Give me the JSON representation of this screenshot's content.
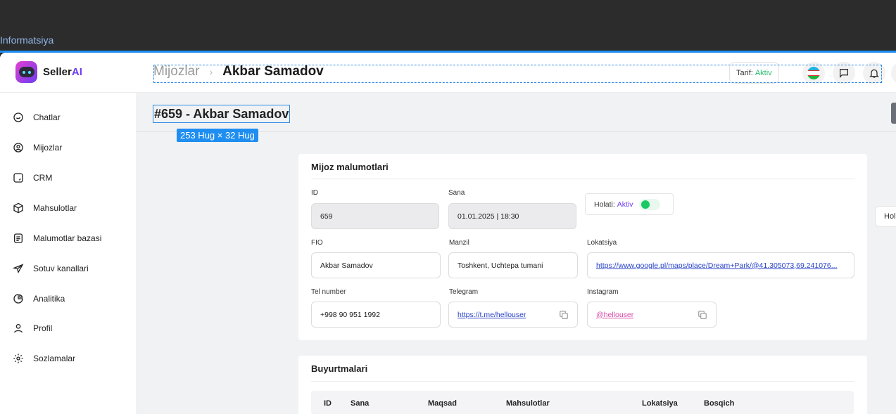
{
  "frame": {
    "label": "Informatsiya"
  },
  "brand": {
    "name_prefix": "Seller",
    "name_suffix": "AI"
  },
  "breadcrumb": {
    "parent": "Mijozlar",
    "separator": "›",
    "current": "Akbar Samadov"
  },
  "header": {
    "tariff_label": "Tarif:",
    "tariff_value": "Aktiv"
  },
  "sidebar": {
    "items": [
      {
        "label": "Chatlar",
        "icon": "chat-icon"
      },
      {
        "label": "Mijozlar",
        "icon": "user-circle-icon"
      },
      {
        "label": "CRM",
        "icon": "crm-icon"
      },
      {
        "label": "Mahsulotlar",
        "icon": "box-icon"
      },
      {
        "label": "Malumotlar bazasi",
        "icon": "document-icon"
      },
      {
        "label": "Sotuv kanallari",
        "icon": "send-icon"
      },
      {
        "label": "Analitika",
        "icon": "analytics-icon"
      },
      {
        "label": "Profil",
        "icon": "profile-icon"
      },
      {
        "label": "Sozlamalar",
        "icon": "gear-icon"
      }
    ]
  },
  "page": {
    "title": "#659 - Akbar Samadov",
    "size_badge": "253 Hug × 32 Hug",
    "side_chip": "Hol"
  },
  "client": {
    "section_title": "Mijoz malumotlari",
    "id_label": "ID",
    "id_value": "659",
    "date_label": "Sana",
    "date_value": "01.01.2025 | 18:30",
    "status_label": "Holati:",
    "status_value": "Aktiv",
    "fio_label": "FIO",
    "fio_value": "Akbar Samadov",
    "address_label": "Manzil",
    "address_value": "Toshkent, Uchtepa tumani",
    "location_label": "Lokatsiya",
    "location_value": "https://www.google.pl/maps/place/Dream+Park/@41.305073,69.241076...",
    "phone_label": "Tel number",
    "phone_value": "+998 90 951 1992",
    "telegram_label": "Telegram",
    "telegram_value": "https://t.me/hellouser",
    "instagram_label": "Instagram",
    "instagram_value": "@hellouser"
  },
  "orders": {
    "section_title": "Buyurtmalari",
    "columns": [
      "ID",
      "Sana",
      "Maqsad",
      "Mahsulotlar",
      "Lokatsiya",
      "Bosqich"
    ]
  },
  "colors": {
    "accent": "#6b3df0",
    "active_green": "#2bbd6e",
    "selection_blue": "#1f8ef1",
    "link_blue": "#2a43c9",
    "instagram_pink": "#d84aa8"
  }
}
